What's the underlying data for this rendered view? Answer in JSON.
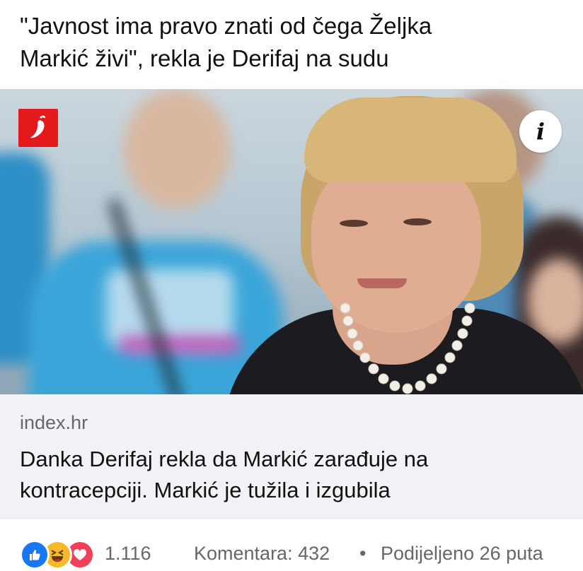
{
  "post": {
    "text_line_1": "\"Javnost ima pravo znati od čega Željka",
    "text_line_2": "Markić živi\", rekla je Derifaj na sudu"
  },
  "image": {
    "brand_icon": "chili-pepper-icon",
    "info_icon": "info-icon",
    "info_label": "i",
    "brand_color": "#e3191b"
  },
  "link_card": {
    "domain": "index.hr",
    "title_line_1": "Danka Derifaj rekla da Markić zarađuje na",
    "title_line_2": "kontracepciji. Markić je tužila i izgubila"
  },
  "footer": {
    "reactions": [
      "like-icon",
      "haha-icon",
      "love-icon"
    ],
    "reaction_count": "1.116",
    "comments": "Komentara: 432",
    "separator": "•",
    "shares": "Podijeljeno 26 puta"
  }
}
